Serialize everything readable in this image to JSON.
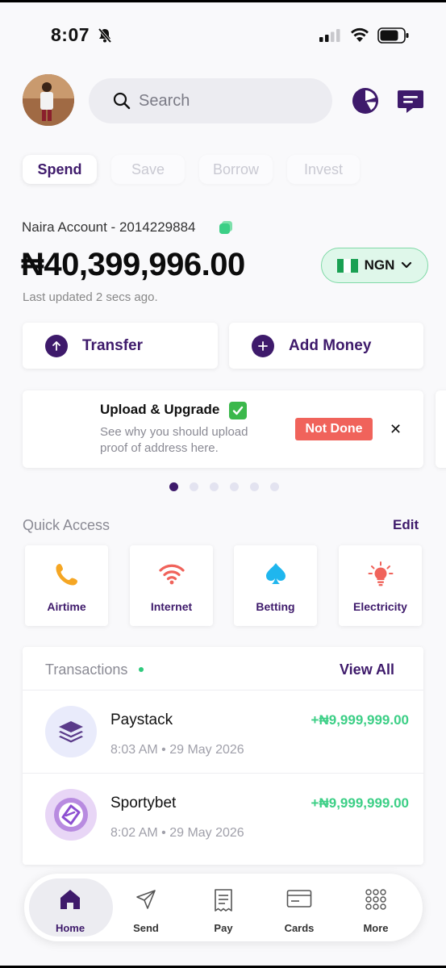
{
  "status_bar": {
    "time": "8:07"
  },
  "header": {
    "search_placeholder": "Search"
  },
  "tabs": [
    {
      "label": "Spend",
      "active": true
    },
    {
      "label": "Save",
      "active": false
    },
    {
      "label": "Borrow",
      "active": false
    },
    {
      "label": "Invest",
      "active": false
    }
  ],
  "account": {
    "label": "Naira Account - 2014229884",
    "balance": "₦40,399,996.00",
    "last_updated": "Last updated 2 secs ago.",
    "currency": "NGN"
  },
  "actions": {
    "transfer_label": "Transfer",
    "add_money_label": "Add Money"
  },
  "upgrade_card": {
    "title": "Upload & Upgrade",
    "description": "See why you should upload proof of address here.",
    "status": "Not Done"
  },
  "carousel": {
    "count": 6,
    "active_index": 0
  },
  "quick_access": {
    "title": "Quick Access",
    "edit_label": "Edit",
    "items": [
      {
        "label": "Airtime",
        "icon": "phone-icon"
      },
      {
        "label": "Internet",
        "icon": "wifi-icon"
      },
      {
        "label": "Betting",
        "icon": "spade-icon"
      },
      {
        "label": "Electricity",
        "icon": "bulb-icon"
      }
    ]
  },
  "transactions": {
    "title": "Transactions",
    "view_all_label": "View All",
    "items": [
      {
        "name": "Paystack",
        "time": "8:03 AM • 29 May 2026",
        "amount": "+₦9,999,999.00"
      },
      {
        "name": "Sportybet",
        "time": "8:02 AM • 29 May 2026",
        "amount": "+₦9,999,999.00"
      }
    ]
  },
  "bottom_nav": [
    {
      "label": "Home",
      "icon": "home-icon",
      "active": true
    },
    {
      "label": "Send",
      "icon": "send-icon",
      "active": false
    },
    {
      "label": "Pay",
      "icon": "receipt-icon",
      "active": false
    },
    {
      "label": "Cards",
      "icon": "card-icon",
      "active": false
    },
    {
      "label": "More",
      "icon": "grid-icon",
      "active": false
    }
  ],
  "colors": {
    "brand": "#3e1a6b",
    "accent_green": "#3ccf86",
    "alert_red": "#f0635b"
  }
}
